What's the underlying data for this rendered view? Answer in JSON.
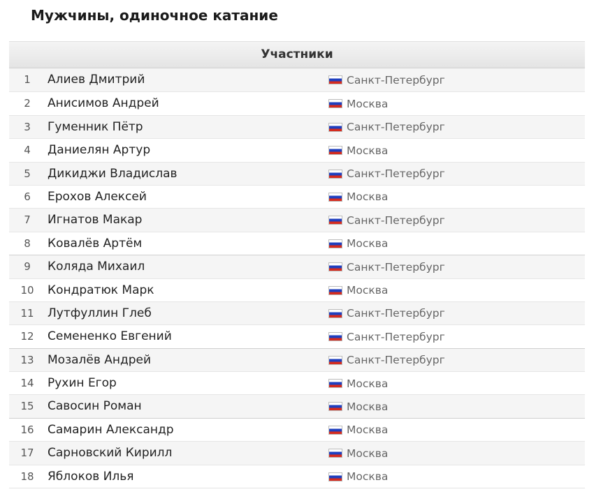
{
  "title": "Мужчины, одиночное катание",
  "table": {
    "header": "Участники",
    "flag_icon": "russia-flag-icon",
    "flag_colors": [
      "#ffffff",
      "#1f3fbf",
      "#d52b1e"
    ],
    "rows": [
      {
        "num": "1",
        "name": "Алиев Дмитрий",
        "city": "Санкт-Петербург"
      },
      {
        "num": "2",
        "name": "Анисимов Андрей",
        "city": "Москва"
      },
      {
        "num": "3",
        "name": "Гуменник Пётр",
        "city": "Санкт-Петербург"
      },
      {
        "num": "4",
        "name": "Даниелян Артур",
        "city": "Москва"
      },
      {
        "num": "5",
        "name": "Дикиджи Владислав",
        "city": "Санкт-Петербург"
      },
      {
        "num": "6",
        "name": "Ерохов Алексей",
        "city": "Москва"
      },
      {
        "num": "7",
        "name": "Игнатов Макар",
        "city": "Санкт-Петербург"
      },
      {
        "num": "8",
        "name": "Ковалёв Артём",
        "city": "Москва"
      },
      {
        "num": "9",
        "name": "Коляда Михаил",
        "city": "Санкт-Петербург"
      },
      {
        "num": "10",
        "name": "Кондратюк Марк",
        "city": "Москва"
      },
      {
        "num": "11",
        "name": "Лутфуллин Глеб",
        "city": "Санкт-Петербург"
      },
      {
        "num": "12",
        "name": "Семененко Евгений",
        "city": "Санкт-Петербург"
      },
      {
        "num": "13",
        "name": "Мозалёв Андрей",
        "city": "Санкт-Петербург"
      },
      {
        "num": "14",
        "name": "Рухин Егор",
        "city": "Москва"
      },
      {
        "num": "15",
        "name": "Савосин Роман",
        "city": "Москва"
      },
      {
        "num": "16",
        "name": "Самарин Александр",
        "city": "Москва"
      },
      {
        "num": "17",
        "name": "Сарновский Кирилл",
        "city": "Москва"
      },
      {
        "num": "18",
        "name": "Яблоков Илья",
        "city": "Москва"
      }
    ]
  }
}
